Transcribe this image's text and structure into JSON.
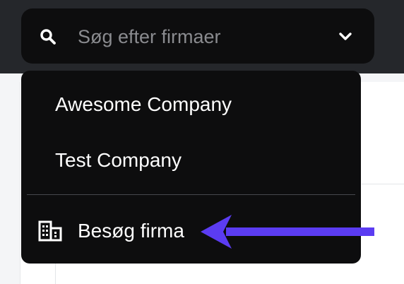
{
  "search": {
    "placeholder": "Søg efter firmaer",
    "icon": "search-icon",
    "toggle_icon": "chevron-down-icon"
  },
  "dropdown": {
    "items": [
      {
        "label": "Awesome Company"
      },
      {
        "label": "Test Company"
      }
    ],
    "visit": {
      "label": "Besøg firma",
      "icon": "building-icon"
    }
  },
  "annotation": {
    "arrow_color": "#5b3cf2"
  },
  "colors": {
    "panel": "#0d0d0e",
    "topbar": "#25272b",
    "placeholder": "#8a8b8f",
    "divider": "#46484d"
  }
}
